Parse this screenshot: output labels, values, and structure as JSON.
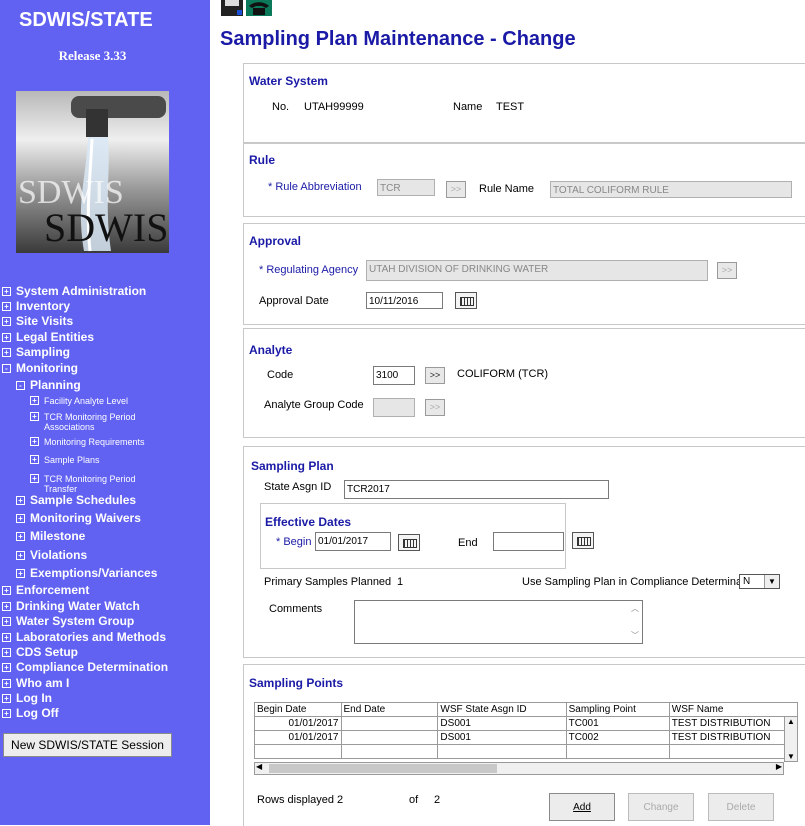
{
  "sidebar": {
    "app_title": "SDWIS/STATE",
    "release": "Release 3.33",
    "logo_text": "SDWIS",
    "nav": [
      {
        "label": "System Administration",
        "level": 0,
        "expander": "+"
      },
      {
        "label": "Inventory",
        "level": 0,
        "expander": "+"
      },
      {
        "label": "Site Visits",
        "level": 0,
        "expander": "+"
      },
      {
        "label": "Legal Entities",
        "level": 0,
        "expander": "+"
      },
      {
        "label": "Sampling",
        "level": 0,
        "expander": "+"
      },
      {
        "label": "Monitoring",
        "level": 0,
        "expander": "-"
      },
      {
        "label": "Planning",
        "level": 1,
        "expander": "-"
      },
      {
        "label": "Facility Analyte Level",
        "level": 2,
        "expander": "+"
      },
      {
        "label": "TCR Monitoring Period Associations",
        "level": 2,
        "expander": "+"
      },
      {
        "label": "Monitoring Requirements",
        "level": 2,
        "expander": "+"
      },
      {
        "label": "Sample Plans",
        "level": 2,
        "expander": "+"
      },
      {
        "label": "TCR Monitoring Period Transfer",
        "level": 2,
        "expander": "+"
      },
      {
        "label": "Sample Schedules",
        "level": 1,
        "expander": "+"
      },
      {
        "label": "Monitoring Waivers",
        "level": 1,
        "expander": "+"
      },
      {
        "label": "Milestone",
        "level": 1,
        "expander": "+"
      },
      {
        "label": "Violations",
        "level": 1,
        "expander": "+"
      },
      {
        "label": "Exemptions/Variances",
        "level": 1,
        "expander": "+"
      },
      {
        "label": "Enforcement",
        "level": 0,
        "expander": "+"
      },
      {
        "label": "Drinking Water Watch",
        "level": 0,
        "expander": "+"
      },
      {
        "label": "Water System Group",
        "level": 0,
        "expander": "+"
      },
      {
        "label": "Laboratories and Methods",
        "level": 0,
        "expander": "+"
      },
      {
        "label": "CDS Setup",
        "level": 0,
        "expander": "+"
      },
      {
        "label": "Compliance Determination",
        "level": 0,
        "expander": "+"
      },
      {
        "label": "Who am I",
        "level": 0,
        "expander": "+"
      },
      {
        "label": "Log In",
        "level": 0,
        "expander": "+"
      },
      {
        "label": "Log Off",
        "level": 0,
        "expander": "+"
      }
    ],
    "session_button": "New SDWIS/STATE Session"
  },
  "page": {
    "title": "Sampling Plan Maintenance - Change"
  },
  "water_system": {
    "heading": "Water System",
    "no_label": "No.",
    "no_value": "UTAH99999",
    "name_label": "Name",
    "name_value": "TEST"
  },
  "rule": {
    "heading": "Rule",
    "abbrev_label": "* Rule Abbreviation",
    "abbrev_value": "TCR",
    "name_label": "Rule Name",
    "name_value": "TOTAL COLIFORM RULE"
  },
  "approval": {
    "heading": "Approval",
    "agency_label": "* Regulating Agency",
    "agency_value": "UTAH DIVISION OF DRINKING WATER",
    "date_label": "Approval Date",
    "date_value": "10/11/2016"
  },
  "analyte": {
    "heading": "Analyte",
    "code_label": "Code",
    "code_value": "3100",
    "code_desc": "COLIFORM (TCR)",
    "group_label": "Analyte Group Code",
    "group_value": ""
  },
  "sampling_plan": {
    "heading": "Sampling Plan",
    "state_id_label": "State Asgn ID",
    "state_id_value": "TCR2017",
    "eff_heading": "Effective Dates",
    "begin_label": "* Begin",
    "begin_value": "01/01/2017",
    "end_label": "End",
    "end_value": "",
    "primary_label": "Primary Samples Planned",
    "primary_value": "1",
    "compliance_label": "Use Sampling Plan in Compliance Determinatio",
    "compliance_value": "N",
    "comments_label": "Comments",
    "comments_value": ""
  },
  "sampling_points": {
    "heading": "Sampling Points",
    "columns": [
      "Begin Date",
      "End Date",
      "WSF State Asgn ID",
      "Sampling Point",
      "WSF Name"
    ],
    "rows": [
      [
        "01/01/2017",
        "",
        "DS001",
        "TC001",
        "TEST DISTRIBUTION"
      ],
      [
        "01/01/2017",
        "",
        "DS001",
        "TC002",
        "TEST DISTRIBUTION"
      ],
      [
        "",
        "",
        "",
        "",
        ""
      ]
    ],
    "rows_label": "Rows displayed",
    "rows_value": "2",
    "of_label": "of",
    "of_value": "2"
  },
  "buttons": {
    "add": "Add",
    "change": "Change",
    "delete": "Delete",
    "lookup": ">>"
  },
  "colors": {
    "sidebar_bg": "#6161f2",
    "heading": "#1a1aa6"
  }
}
